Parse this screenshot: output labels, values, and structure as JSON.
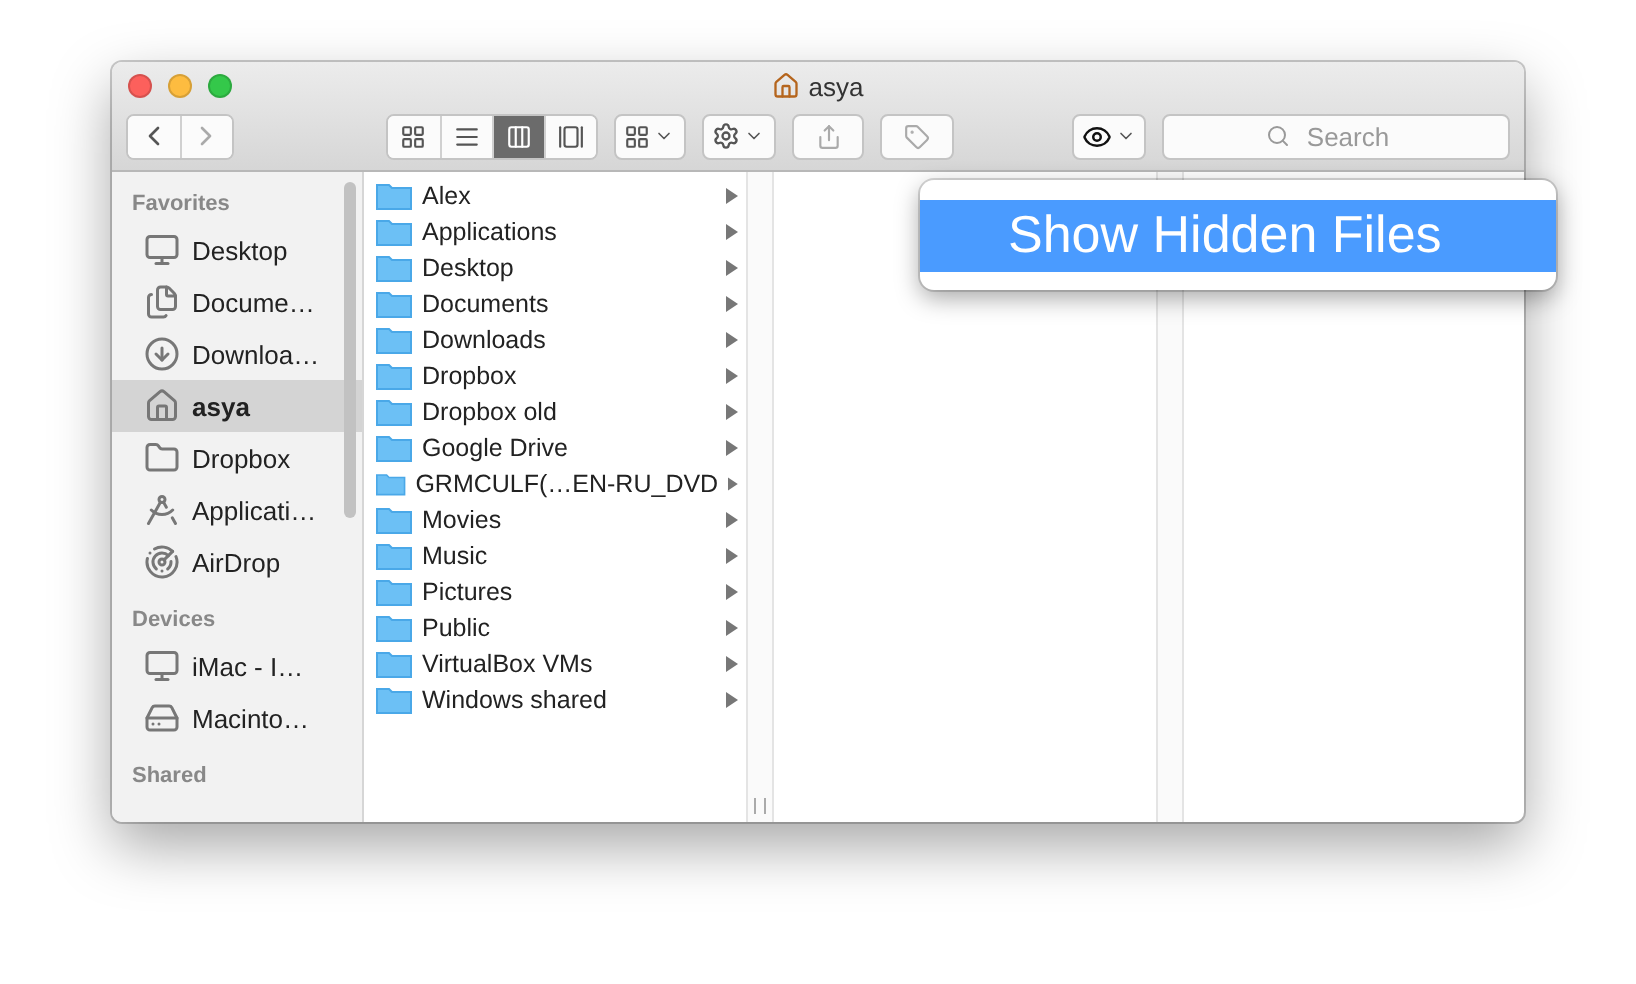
{
  "window": {
    "title": "asya"
  },
  "toolbar": {
    "view_buttons": [
      {
        "selected": false
      },
      {
        "selected": false
      },
      {
        "selected": true
      },
      {
        "selected": false
      }
    ],
    "search": {
      "placeholder": "Search"
    }
  },
  "sidebar": {
    "sections": [
      {
        "header": "Favorites",
        "items": [
          {
            "label": "Desktop",
            "selected": false
          },
          {
            "label": "Docume…",
            "selected": false
          },
          {
            "label": "Downloa…",
            "selected": false
          },
          {
            "label": "asya",
            "selected": true
          },
          {
            "label": "Dropbox",
            "selected": false
          },
          {
            "label": "Applicati…",
            "selected": false
          },
          {
            "label": "AirDrop",
            "selected": false
          }
        ]
      },
      {
        "header": "Devices",
        "items": [
          {
            "label": "iMac - I…",
            "selected": false
          },
          {
            "label": "Macinto…",
            "selected": false
          }
        ]
      },
      {
        "header": "Shared"
      }
    ]
  },
  "file_column": {
    "items": [
      {
        "label": "Alex"
      },
      {
        "label": "Applications"
      },
      {
        "label": "Desktop"
      },
      {
        "label": "Documents"
      },
      {
        "label": "Downloads"
      },
      {
        "label": "Dropbox"
      },
      {
        "label": "Dropbox old"
      },
      {
        "label": "Google Drive"
      },
      {
        "label": "GRMCULF(…EN-RU_DVD"
      },
      {
        "label": "Movies"
      },
      {
        "label": "Music"
      },
      {
        "label": "Pictures"
      },
      {
        "label": "Public"
      },
      {
        "label": "VirtualBox VMs"
      },
      {
        "label": "Windows shared"
      }
    ]
  },
  "popup": {
    "label": "Show Hidden Files"
  }
}
